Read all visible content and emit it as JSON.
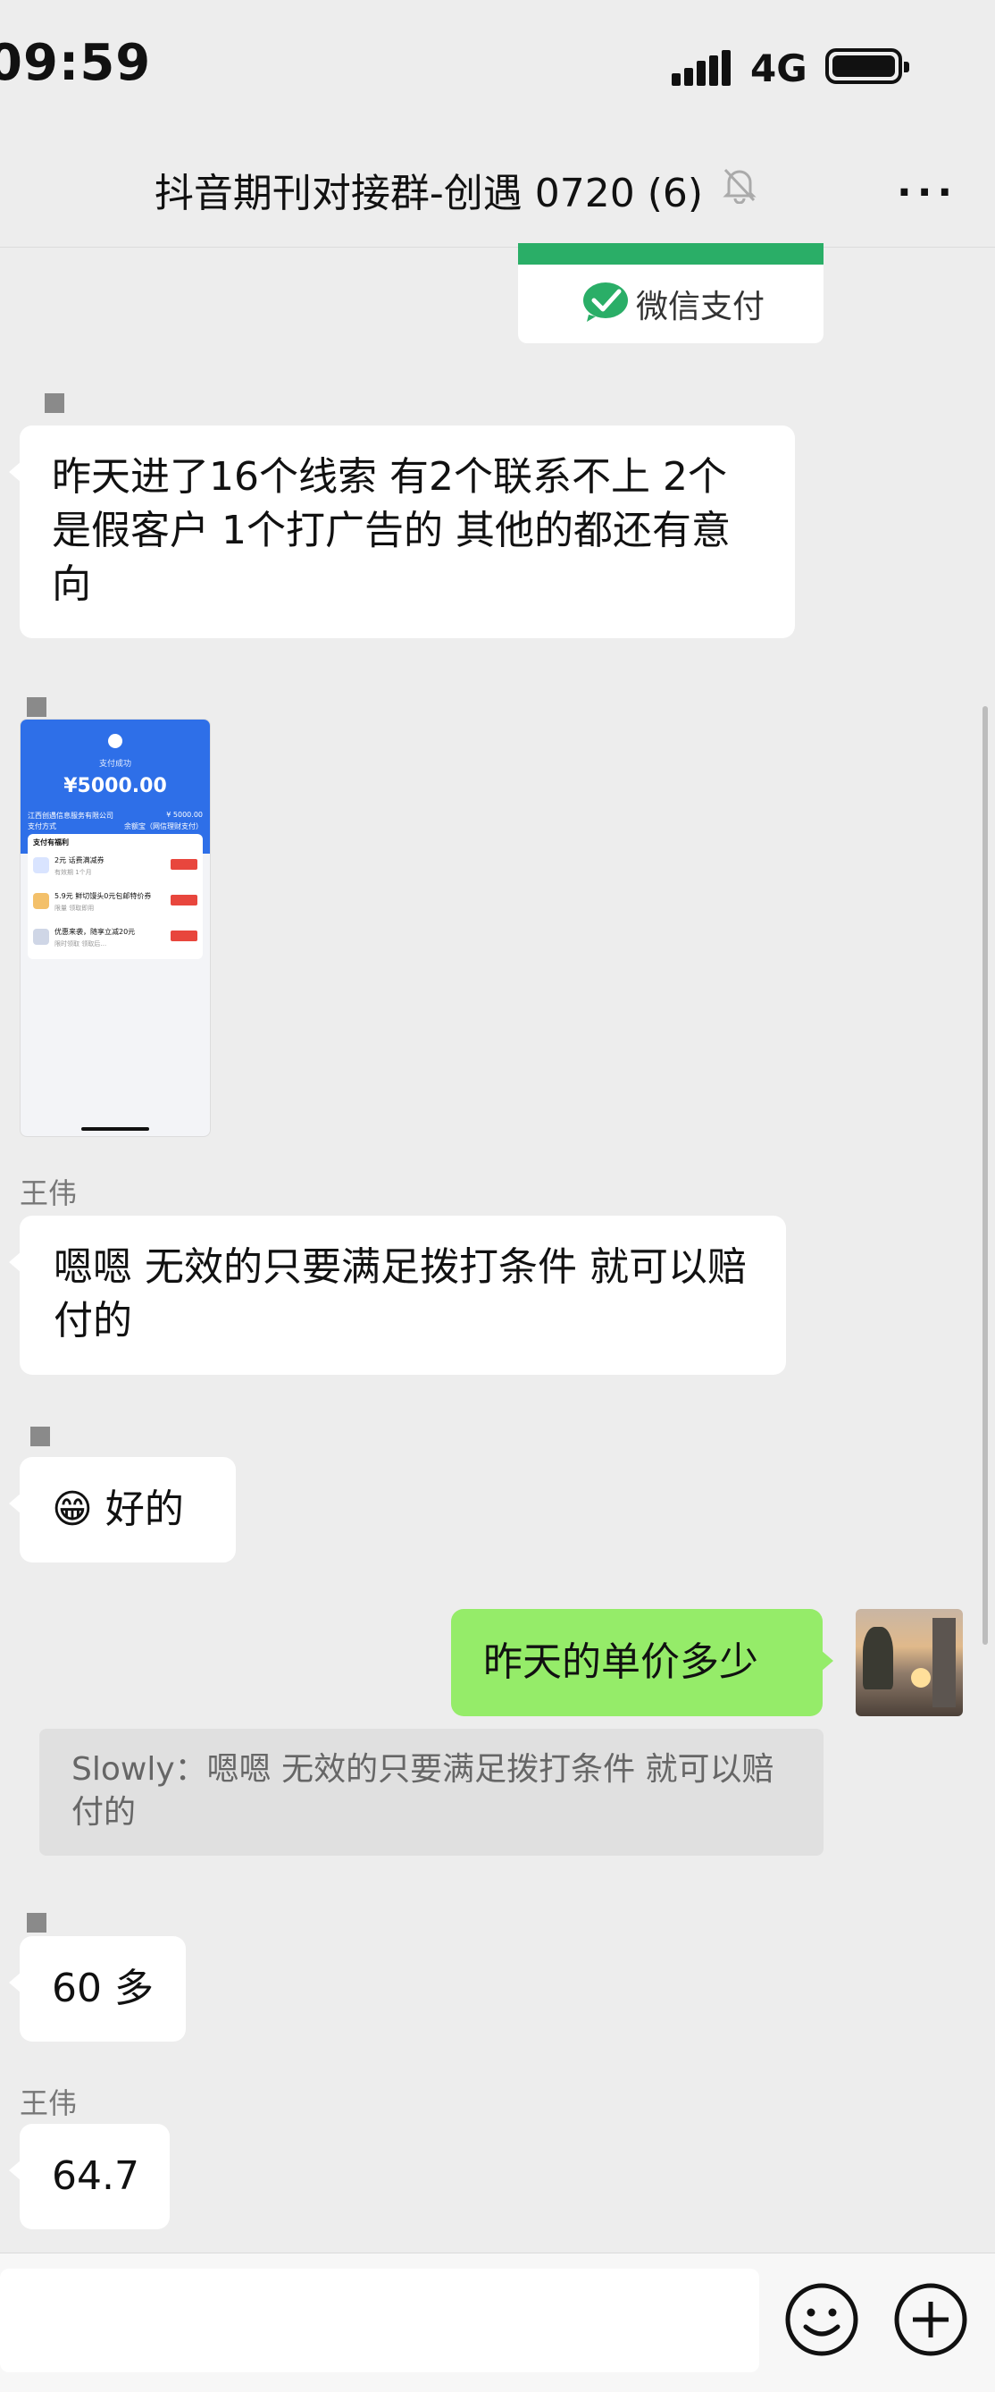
{
  "status_bar": {
    "time": "09:59",
    "network": "4G"
  },
  "header": {
    "title": "抖音期刊对接群-创遇 0720 (6)",
    "more": "···"
  },
  "pay_card": {
    "label": "微信支付"
  },
  "messages": {
    "m1": {
      "text": "昨天进了16个线索 有2个联系不上 2个是假客户 1个打广告的 其他的都还有意向"
    },
    "m2": {
      "screenshot": {
        "header": "支付成功",
        "amount": "¥5000.00",
        "merchant": "江西创遇信息服务有限公司",
        "merchant_amount": "¥ 5000.00",
        "method_label": "支付方式",
        "method_value": "余额宝（网信理财支付）",
        "benefits_title": "支付有福利",
        "rows": [
          {
            "title": "2元 话费满减券",
            "sub": "有效期 1个月"
          },
          {
            "title": "5.9元 鲜切馒头0元包邮特价券",
            "sub": "限量 领取即用"
          },
          {
            "title": "优惠来袭，随享立减20元",
            "sub": "限时领取 领取后…"
          }
        ]
      }
    },
    "m3": {
      "sender": "王伟",
      "text": "嗯嗯  无效的只要满足拨打条件  就可以赔付的"
    },
    "m4": {
      "emoji": "😁",
      "text": "好的"
    },
    "m5": {
      "text": "昨天的单价多少",
      "quote": "Slowly：嗯嗯  无效的只要满足拨打条件  就可以赔付的"
    },
    "m6": {
      "text": "60 多"
    },
    "m7": {
      "sender": "王伟",
      "text": "64.7"
    }
  },
  "input_bar": {
    "emoji_icon": "smiley-icon",
    "plus_icon": "plus-icon"
  }
}
